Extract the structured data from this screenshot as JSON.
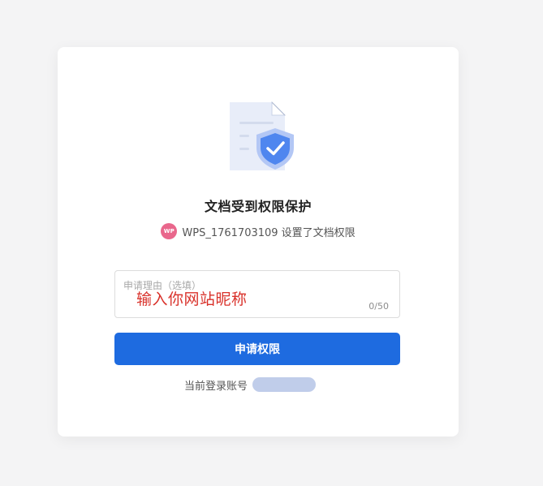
{
  "dialog": {
    "title": "文档受到权限保护",
    "owner": {
      "avatar_text": "WP",
      "name": "WPS_1761703109",
      "action_text": "设置了文档权限",
      "avatar_color": "#e9678c"
    },
    "reason_field": {
      "placeholder": "申请理由（选填）",
      "overlay_text": "输入你网站昵称",
      "counter": "0/50"
    },
    "apply_button_label": "申请权限",
    "account": {
      "label": "当前登录账号"
    },
    "icons": {
      "illustration": "protected-document-icon",
      "shield": "shield-check-icon"
    },
    "colors": {
      "primary": "#1e6be0",
      "overlay_text": "#d9322b",
      "page_bg": "#f4f4f5"
    }
  }
}
